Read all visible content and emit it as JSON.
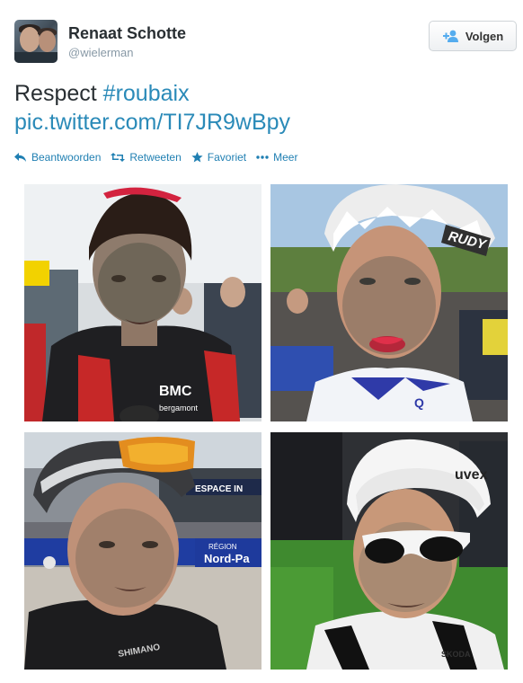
{
  "user": {
    "fullname": "Renaat Schotte",
    "handle": "@wielerman"
  },
  "follow_button": {
    "label": "Volgen"
  },
  "tweet": {
    "text": "Respect",
    "hashtag": "#roubaix",
    "link": "pic.twitter.com/TI7JR9wBpy"
  },
  "actions": [
    {
      "label": "Beantwoorden",
      "icon": "reply-icon"
    },
    {
      "label": "Retweeten",
      "icon": "retweet-icon"
    },
    {
      "label": "Favoriet",
      "icon": "star-icon"
    },
    {
      "label": "Meer",
      "icon": "more-icon"
    }
  ],
  "photos": {
    "photo_1": {
      "jersey_text": "BMC",
      "sponsor_text": "bergamont"
    },
    "photo_2": {
      "helmet_text": "RUDY",
      "jersey_text": "Q"
    },
    "photo_3": {
      "banner_region": "RÉGION",
      "banner_name": "Nord-Pa",
      "sign_text": "ESPACE IN",
      "jersey_text": "SHIMANO"
    },
    "photo_4": {
      "helmet_text": "uvex",
      "jersey_text": "SKODA"
    }
  },
  "colors": {
    "link": "#2a8ab8",
    "action": "#1f7fb2",
    "name": "#292f33",
    "handle": "#8899a6"
  }
}
